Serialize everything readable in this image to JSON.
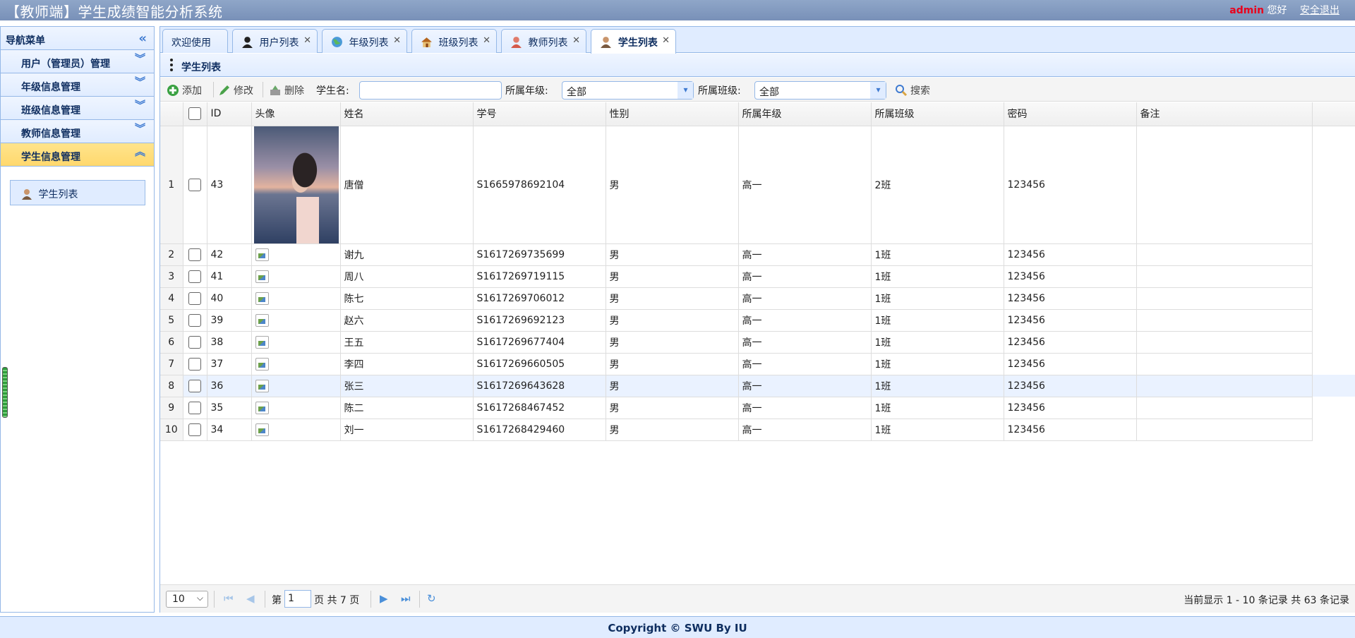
{
  "header": {
    "title": "【教师端】学生成绩智能分析系统",
    "user": "admin",
    "greeting": "您好",
    "logout": "安全退出"
  },
  "sidebar": {
    "title": "导航菜单",
    "items": [
      {
        "label": "用户（管理员）管理",
        "expanded": false
      },
      {
        "label": "年级信息管理",
        "expanded": false
      },
      {
        "label": "班级信息管理",
        "expanded": false
      },
      {
        "label": "教师信息管理",
        "expanded": false
      },
      {
        "label": "学生信息管理",
        "expanded": true
      }
    ],
    "sub_item": "学生列表"
  },
  "tabs": [
    {
      "label": "欢迎使用",
      "icon": "none",
      "closable": false
    },
    {
      "label": "用户列表",
      "icon": "user-icon",
      "closable": true
    },
    {
      "label": "年级列表",
      "icon": "globe-icon",
      "closable": true
    },
    {
      "label": "班级列表",
      "icon": "house-icon",
      "closable": true
    },
    {
      "label": "教师列表",
      "icon": "teacher-icon",
      "closable": true
    },
    {
      "label": "学生列表",
      "icon": "student-icon",
      "closable": true,
      "active": true
    }
  ],
  "panel_title": "学生列表",
  "toolbar": {
    "add": "添加",
    "edit": "修改",
    "delete": "删除",
    "name_label": "学生名:",
    "name_value": "",
    "grade_label": "所属年级:",
    "grade_value": "全部",
    "class_label": "所属班级:",
    "class_value": "全部",
    "search": "搜索"
  },
  "grid": {
    "columns": [
      "ID",
      "头像",
      "姓名",
      "学号",
      "性别",
      "所属年级",
      "所属班级",
      "密码",
      "备注"
    ],
    "rows": [
      {
        "n": "1",
        "id": "43",
        "avatar": "photo",
        "name": "唐僧",
        "sno": "S1665978692104",
        "gender": "男",
        "grade": "高一",
        "cls": "2班",
        "pwd": "123456",
        "note": ""
      },
      {
        "n": "2",
        "id": "42",
        "avatar": "broken",
        "name": "谢九",
        "sno": "S1617269735699",
        "gender": "男",
        "grade": "高一",
        "cls": "1班",
        "pwd": "123456",
        "note": ""
      },
      {
        "n": "3",
        "id": "41",
        "avatar": "broken",
        "name": "周八",
        "sno": "S1617269719115",
        "gender": "男",
        "grade": "高一",
        "cls": "1班",
        "pwd": "123456",
        "note": ""
      },
      {
        "n": "4",
        "id": "40",
        "avatar": "broken",
        "name": "陈七",
        "sno": "S1617269706012",
        "gender": "男",
        "grade": "高一",
        "cls": "1班",
        "pwd": "123456",
        "note": ""
      },
      {
        "n": "5",
        "id": "39",
        "avatar": "broken",
        "name": "赵六",
        "sno": "S1617269692123",
        "gender": "男",
        "grade": "高一",
        "cls": "1班",
        "pwd": "123456",
        "note": ""
      },
      {
        "n": "6",
        "id": "38",
        "avatar": "broken",
        "name": "王五",
        "sno": "S1617269677404",
        "gender": "男",
        "grade": "高一",
        "cls": "1班",
        "pwd": "123456",
        "note": ""
      },
      {
        "n": "7",
        "id": "37",
        "avatar": "broken",
        "name": "李四",
        "sno": "S1617269660505",
        "gender": "男",
        "grade": "高一",
        "cls": "1班",
        "pwd": "123456",
        "note": ""
      },
      {
        "n": "8",
        "id": "36",
        "avatar": "broken",
        "name": "张三",
        "sno": "S1617269643628",
        "gender": "男",
        "grade": "高一",
        "cls": "1班",
        "pwd": "123456",
        "note": "",
        "selected": true
      },
      {
        "n": "9",
        "id": "35",
        "avatar": "broken",
        "name": "陈二",
        "sno": "S1617268467452",
        "gender": "男",
        "grade": "高一",
        "cls": "1班",
        "pwd": "123456",
        "note": ""
      },
      {
        "n": "10",
        "id": "34",
        "avatar": "broken",
        "name": "刘一",
        "sno": "S1617268429460",
        "gender": "男",
        "grade": "高一",
        "cls": "1班",
        "pwd": "123456",
        "note": ""
      }
    ]
  },
  "pager": {
    "page_size": "10",
    "page_prefix": "第",
    "page": "1",
    "page_suffix": "页 共 7 页",
    "info": "当前显示 1 - 10 条记录 共 63 条记录"
  },
  "footer": "Copyright © SWU By IU",
  "colors": {
    "header_bg": "#7890b8",
    "accent_border": "#95b8e7",
    "panel_bg": "#e0ecff",
    "active_nav": "#ffd86d",
    "admin_red": "#e8001c"
  }
}
